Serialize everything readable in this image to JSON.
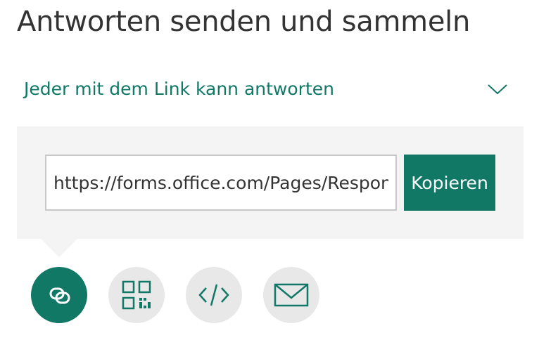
{
  "title": "Antworten senden und sammeln",
  "permission": {
    "label": "Jeder mit dem Link kann antworten",
    "icon": "chevron-down-icon"
  },
  "link_panel": {
    "url_value": "https://forms.office.com/Pages/ResponsePage.aspx",
    "copy_label": "Kopieren"
  },
  "share_options": [
    {
      "name": "link",
      "icon": "link-icon",
      "active": true
    },
    {
      "name": "qr-code",
      "icon": "qr-code-icon",
      "active": false
    },
    {
      "name": "embed",
      "icon": "code-icon",
      "active": false
    },
    {
      "name": "email",
      "icon": "mail-icon",
      "active": false
    }
  ],
  "colors": {
    "accent": "#117865",
    "panel_bg": "#f4f4f4",
    "inactive_circle": "#e8e8e8",
    "title_text": "#333333"
  }
}
